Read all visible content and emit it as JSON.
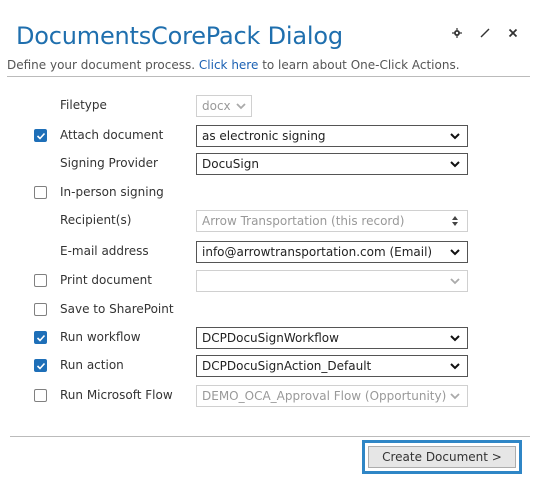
{
  "dialog": {
    "title": "DocumentsCorePack Dialog",
    "subtitle_before": "Define your document process.",
    "subtitle_link": "Click here",
    "subtitle_after": "to learn about One-Click Actions."
  },
  "form": {
    "filetype": {
      "label": "Filetype",
      "value": "docx"
    },
    "attach_document": {
      "label": "Attach document",
      "checked": true,
      "value": "as electronic signing"
    },
    "signing_provider": {
      "label": "Signing Provider",
      "value": "DocuSign"
    },
    "in_person_signing": {
      "label": "In-person signing",
      "checked": false
    },
    "recipients": {
      "label": "Recipient(s)",
      "value": "Arrow Transportation (this record)"
    },
    "email_address": {
      "label": "E-mail address",
      "value": "info@arrowtransportation.com (Email)"
    },
    "print_document": {
      "label": "Print document",
      "checked": false,
      "value": ""
    },
    "save_sharepoint": {
      "label": "Save to SharePoint",
      "checked": false
    },
    "run_workflow": {
      "label": "Run workflow",
      "checked": true,
      "value": "DCPDocuSignWorkflow"
    },
    "run_action": {
      "label": "Run action",
      "checked": true,
      "value": "DCPDocuSignAction_Default"
    },
    "run_flow": {
      "label": "Run Microsoft Flow",
      "checked": false,
      "value": "DEMO_OCA_Approval Flow (Opportunity)"
    }
  },
  "footer": {
    "create_label": "Create Document >"
  },
  "colors": {
    "accent": "#1f6fae",
    "checkbox_on": "#1e6fb8",
    "button_highlight": "#2f86c6"
  },
  "icons": [
    "gear-icon",
    "pin-icon",
    "close-icon",
    "chevron-down-icon",
    "spin-arrows-icon",
    "checkmark-icon"
  ]
}
